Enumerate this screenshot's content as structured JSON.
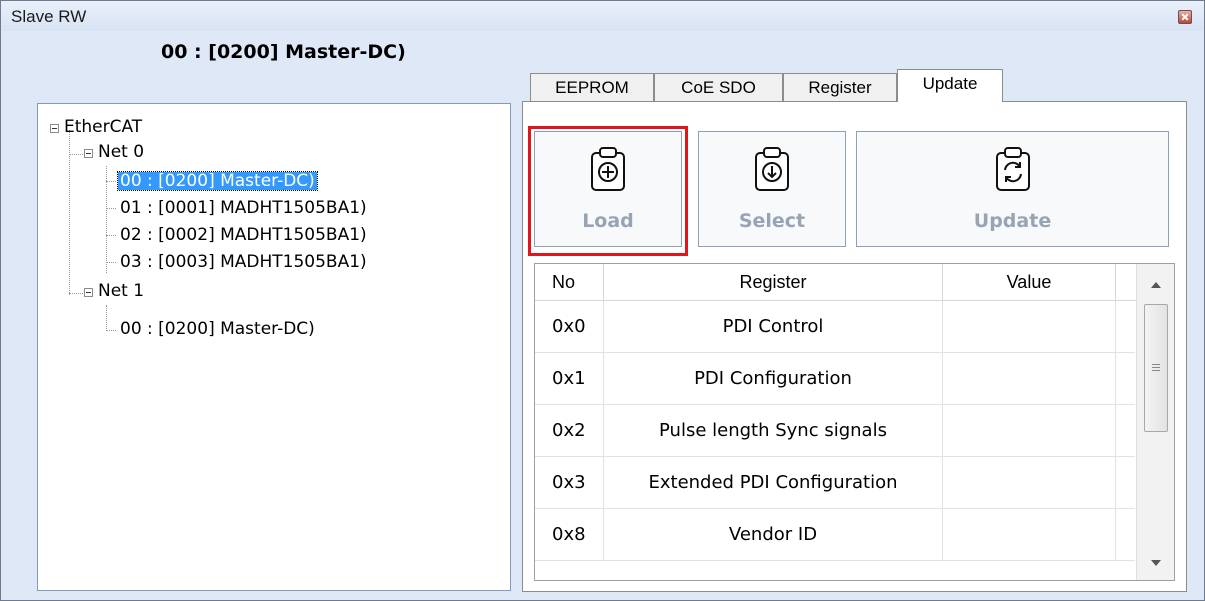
{
  "window": {
    "title": "Slave RW"
  },
  "left_panel": {
    "header": "00 : [0200] Master-DC)"
  },
  "tree": {
    "root": "EtherCAT",
    "net0": "Net 0",
    "net0_items": [
      "00 : [0200] Master-DC)",
      "01 : [0001] MADHT1505BA1)",
      "02 : [0002] MADHT1505BA1)",
      "03 : [0003] MADHT1505BA1)"
    ],
    "net1": "Net 1",
    "net1_items": [
      "00 : [0200] Master-DC)"
    ]
  },
  "tabs": [
    "EEPROM",
    "CoE SDO",
    "Register",
    "Update"
  ],
  "active_tab": "Update",
  "buttons": {
    "load": "Load",
    "select": "Select",
    "update": "Update"
  },
  "icons": {
    "load": "clipboard-plus-icon",
    "select": "clipboard-download-icon",
    "update": "clipboard-refresh-icon"
  },
  "table": {
    "headers": [
      "No",
      "Register",
      "Value"
    ],
    "rows": [
      {
        "no": "0x0",
        "register": "PDI Control",
        "value": ""
      },
      {
        "no": "0x1",
        "register": "PDI Configuration",
        "value": ""
      },
      {
        "no": "0x2",
        "register": "Pulse length Sync signals",
        "value": ""
      },
      {
        "no": "0x3",
        "register": "Extended PDI Configuration",
        "value": ""
      },
      {
        "no": "0x8",
        "register": "Vendor ID",
        "value": ""
      }
    ]
  },
  "colors": {
    "highlight": "#e0161c",
    "selection": "#3399ff",
    "window_bg": "#dfe8f6"
  }
}
